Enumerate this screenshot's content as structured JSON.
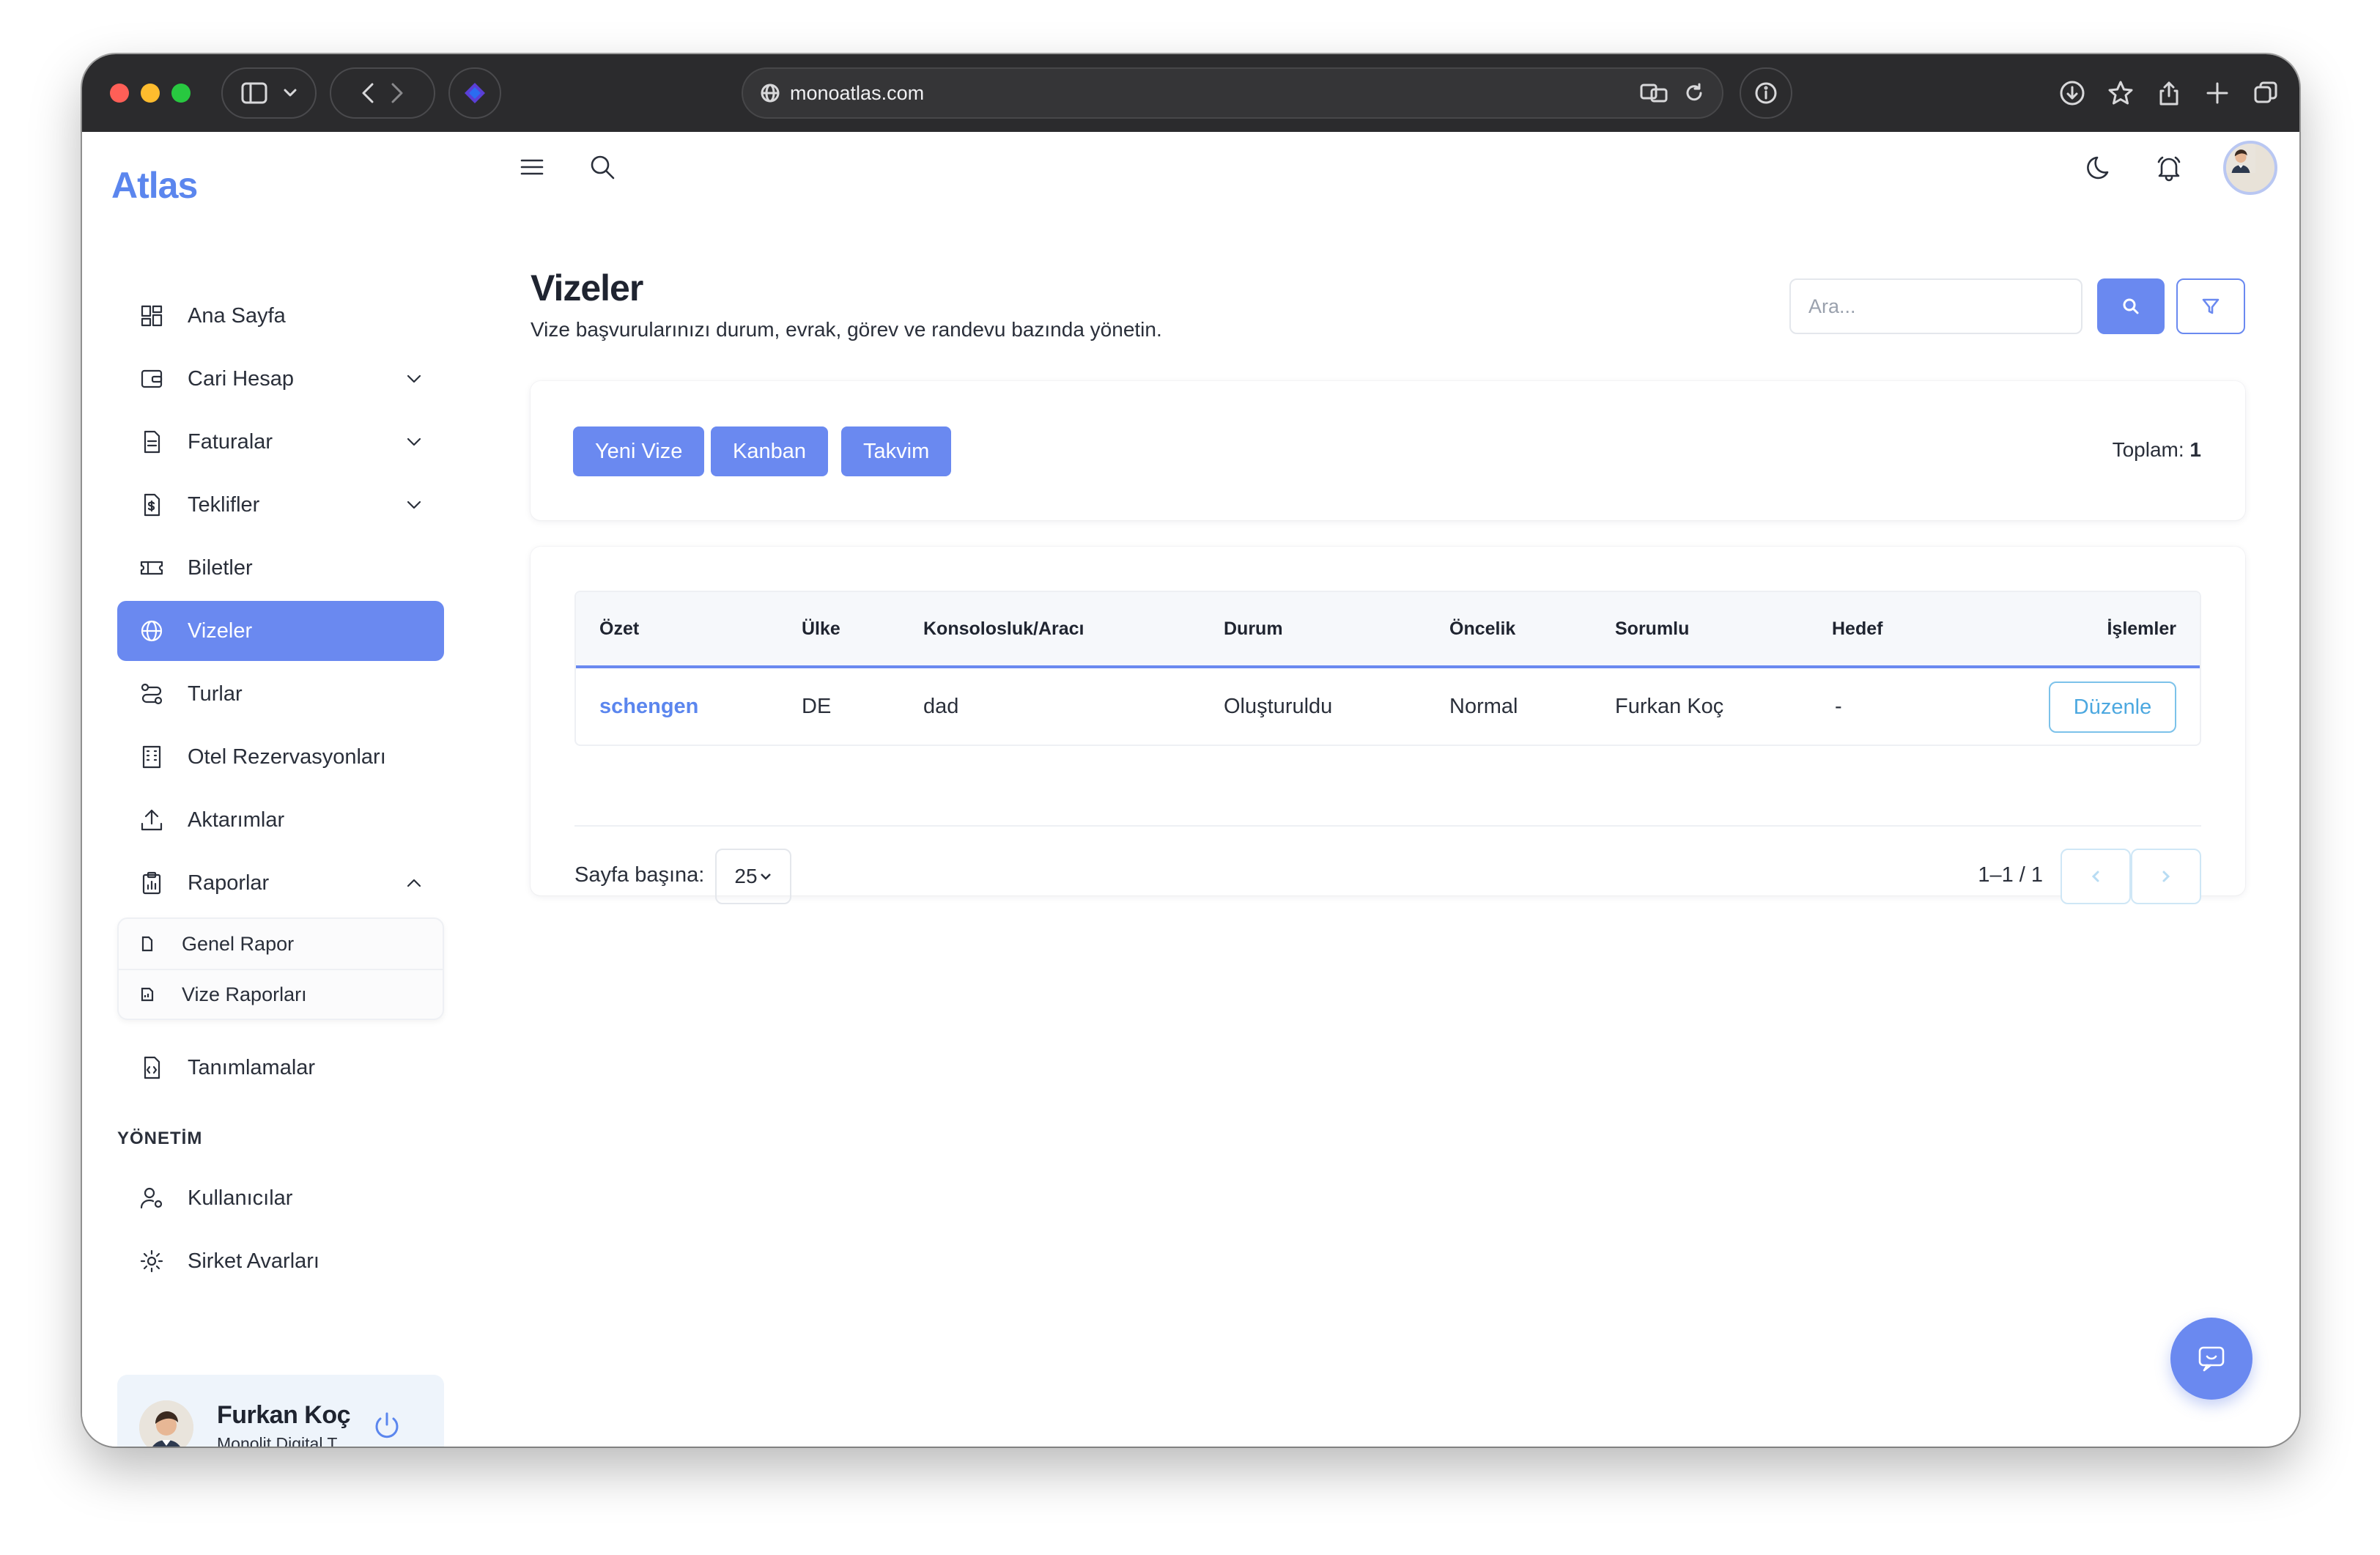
{
  "browser": {
    "url": "monoatlas.com"
  },
  "sidebar": {
    "logo": "Atlas",
    "items": [
      {
        "label": "Ana Sayfa"
      },
      {
        "label": "Cari Hesap"
      },
      {
        "label": "Faturalar"
      },
      {
        "label": "Teklifler"
      },
      {
        "label": "Biletler"
      },
      {
        "label": "Vizeler"
      },
      {
        "label": "Turlar"
      },
      {
        "label": "Otel Rezervasyonları"
      },
      {
        "label": "Aktarımlar"
      },
      {
        "label": "Raporlar"
      }
    ],
    "reports_submenu": [
      {
        "label": "Genel Rapor"
      },
      {
        "label": "Vize Raporları"
      }
    ],
    "definitions": "Tanımlamalar",
    "admin_section_title": "YÖNETİM",
    "admin_items": [
      {
        "label": "Kullanıcılar"
      },
      {
        "label": "Sirket Avarları"
      }
    ],
    "user": {
      "name": "Furkan Koç",
      "company": "Monolit Digital T..."
    }
  },
  "page": {
    "title": "Vizeler",
    "subtitle": "Vize başvurularınızı durum, evrak, görev ve randevu bazında yönetin.",
    "search_placeholder": "Ara..."
  },
  "actions": {
    "new_visa": "Yeni Vize",
    "kanban": "Kanban",
    "calendar": "Takvim",
    "total_label": "Toplam:",
    "total_value": "1"
  },
  "table": {
    "headers": {
      "summary": "Özet",
      "country": "Ülke",
      "consulate": "Konsolosluk/Aracı",
      "status": "Durum",
      "priority": "Öncelik",
      "responsible": "Sorumlu",
      "target": "Hedef",
      "actions": "İşlemler"
    },
    "rows": [
      {
        "summary": "schengen",
        "country": "DE",
        "consulate": "dad",
        "status": "Oluşturuldu",
        "priority": "Normal",
        "responsible": "Furkan Koç",
        "target": "-",
        "edit": "Düzenle"
      }
    ]
  },
  "pagination": {
    "per_page_label": "Sayfa başına:",
    "per_page_value": "25",
    "range": "1–1 / 1"
  },
  "colors": {
    "accent": "#6a89f0",
    "logo": "#5b86ee",
    "edit_border": "#7cc2ea"
  }
}
